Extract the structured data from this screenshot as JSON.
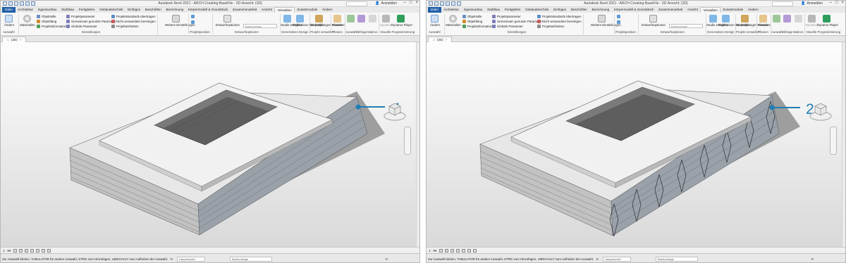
{
  "left": {
    "title": "Autodesk Revit 2021 - ARCH-Creating-BaseFile - 3D-Ansicht: {3D}",
    "user": "Anmelden",
    "menu_tabs": [
      "Datei",
      "Architektur",
      "Ingenieurbau",
      "Stahlbau",
      "Fertigteilen",
      "Gebäudetechnik",
      "Einfügen",
      "Beschriften",
      "Berechnung",
      "Körpermodell & Grundstück",
      "Zusammenarbeit",
      "Ansicht",
      "Verwalten",
      "Zusatzmodule",
      "Ändern"
    ],
    "active_tab": "Verwalten",
    "ribbon": {
      "aendern": "Ändern",
      "materialien": "Materialien",
      "objektstile": "Objektstile",
      "objektfang": "Objektfang",
      "projektinformationen": "Projektinformationen",
      "projektparameter": "Projektparameter",
      "gemeinsam": "Gemeinsam genutzte Parameter",
      "globale": "Globale Parameter",
      "projektstandards": "Projektstandards übertragen",
      "nicht_verwendete": "Nicht verwendete bereinigen",
      "projekteinheiten": "Projekteinheiten",
      "weitere": "Weitere Einstellungen",
      "entwurfsoptionen": "Entwurfsoptionen",
      "basisvorlage": "Basisvorlage",
      "studie": "Studie erstellen",
      "ergebnisse": "Ergebnisse überprüfen",
      "verknuepfungen": "Verknüpfungen verwalten",
      "phasen": "Phasen",
      "auswahl": "Auswahl",
      "abfrage": "Abfrage",
      "makros": "Makros",
      "dynamo": "Dynamo",
      "dynamo_player": "Dynamo Player"
    },
    "panel_labels": {
      "auswahl": "Auswahl",
      "einstellungen": "Einstellungen",
      "projektposition": "Projektposition",
      "entwurfsoptionen": "Entwurfsoptionen",
      "generatives": "Generatives Design",
      "projekt_verwalten": "Projekt verwalten",
      "phasen": "Phasen",
      "auswahl2": "Auswahl",
      "abfrage": "Abfrage",
      "makros": "Makros",
      "visuelle": "Visuelle Programmierung"
    },
    "view_tab": "{3D}",
    "view_scale": "1 : 96",
    "status_message": "Zur Auswahl klicken, TABULATOR für andere Auswahl, STRG zum Hinzufügen, UMSCHALT zum Aufheben der Auswahl.",
    "status_zero": ":0",
    "status_model": "Hauptmodell",
    "status_basis": "Basisvorlage",
    "callout": "1"
  },
  "right": {
    "title": "Autodesk Revit 2021 - ARCH-Creating-BaseFile - 3D-Ansicht: {3D}",
    "user": "Anmelden",
    "menu_tabs": [
      "Datei",
      "Architektur",
      "Ingenieurbau",
      "Stahlbau",
      "Fertigteilen",
      "Gebäudetechnik",
      "Einfügen",
      "Beschriften",
      "Berechnung",
      "Körpermodell & Grundstück",
      "Zusammenarbeit",
      "Ansicht",
      "Verwalten",
      "Zusatzmodule",
      "Ändern"
    ],
    "active_tab": "Verwalten",
    "view_tab": "{3D}",
    "view_scale": "1 : 96",
    "status_message": "Zur Auswahl klicken, TABULATOR für andere Auswahl, STRG zum Hinzufügen, UMSCHALT zum Aufheben der Auswahl.",
    "status_zero": ":0",
    "status_model": "Hauptmodell",
    "status_basis": "Basisvorlage",
    "callout": "2"
  },
  "colors": {
    "callout": "#1f7fb3",
    "file_tab": "#1f5fa8",
    "facade": "#9aa1a8"
  }
}
